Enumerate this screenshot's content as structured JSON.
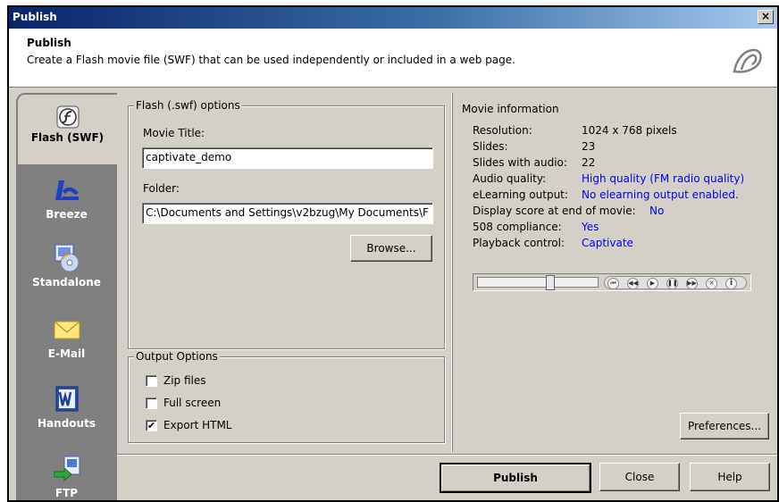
{
  "window": {
    "title": "Publish",
    "close_glyph": "×"
  },
  "header": {
    "title": "Publish",
    "description": "Create a Flash movie file (SWF) that can be used independently or included in a web page."
  },
  "sidebar": {
    "items": [
      {
        "label": "Flash (SWF)",
        "icon": "flash-icon",
        "active": true
      },
      {
        "label": "Breeze",
        "icon": "breeze-icon",
        "active": false
      },
      {
        "label": "Standalone",
        "icon": "standalone-cd-icon",
        "active": false
      },
      {
        "label": "E-Mail",
        "icon": "envelope-icon",
        "active": false
      },
      {
        "label": "Handouts",
        "icon": "word-icon",
        "active": false
      },
      {
        "label": "FTP",
        "icon": "ftp-icon",
        "active": false
      }
    ]
  },
  "flash_options": {
    "group_label": "Flash (.swf) options",
    "movie_title_label": "Movie Title:",
    "movie_title_value": "captivate_demo",
    "folder_label": "Folder:",
    "folder_value": "C:\\Documents and Settings\\v2bzug\\My Documents\\F",
    "browse_label": "Browse..."
  },
  "output_options": {
    "group_label": "Output Options",
    "zip_files": {
      "label": "Zip files",
      "checked": false
    },
    "full_screen": {
      "label": "Full screen",
      "checked": false
    },
    "export_html": {
      "label": "Export HTML",
      "checked": true
    },
    "check_glyph": "✔"
  },
  "movie_info": {
    "heading": "Movie information",
    "rows": [
      {
        "key": "Resolution:",
        "value": "1024 x 768 pixels",
        "link": false
      },
      {
        "key": "Slides:",
        "value": "23",
        "link": false
      },
      {
        "key": "Slides with audio:",
        "value": "22",
        "link": false
      },
      {
        "key": "Audio quality:",
        "value": "High quality (FM radio quality)",
        "link": true
      },
      {
        "key": "eLearning output:",
        "value": "No elearning output enabled.",
        "link": true
      },
      {
        "key": "Display score at end of movie:",
        "value": "No",
        "link": true
      },
      {
        "key": "508 compliance:",
        "value": "Yes",
        "link": true
      },
      {
        "key": "Playback control:",
        "value": "Captivate",
        "link": true
      }
    ],
    "playbar": {
      "position": 0.6,
      "buttons": [
        {
          "icon": "rewind-to-start-icon",
          "glyph": "⏮"
        },
        {
          "icon": "back-icon",
          "glyph": "◀◀"
        },
        {
          "icon": "play-icon",
          "glyph": "▶"
        },
        {
          "icon": "pause-icon",
          "glyph": "❚❚"
        },
        {
          "icon": "forward-icon",
          "glyph": "▶▶"
        },
        {
          "icon": "close-icon",
          "glyph": "✕"
        },
        {
          "icon": "info-icon",
          "glyph": "i"
        }
      ]
    },
    "preferences_label": "Preferences..."
  },
  "footer": {
    "publish_label": "Publish",
    "close_label": "Close",
    "help_label": "Help"
  }
}
